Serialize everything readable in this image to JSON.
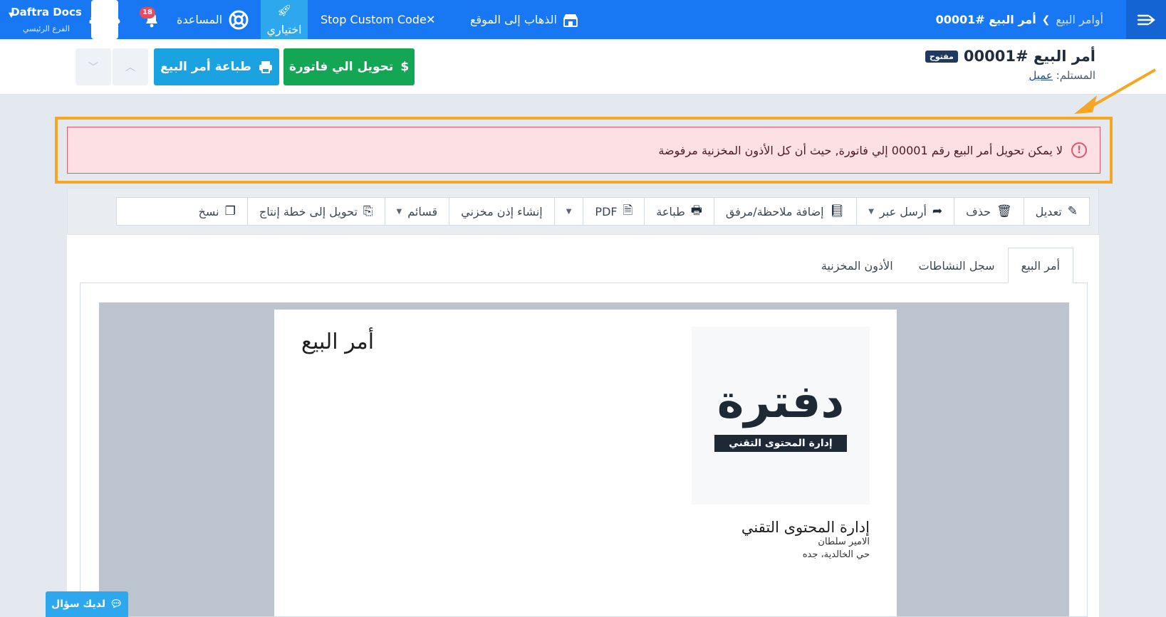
{
  "nav": {
    "breadcrumb_parent": "أوامر البيع",
    "breadcrumb_current": "أمر البيع #00001",
    "go_to_site": "الذهاب إلى الموقع",
    "stop_custom_code": "Stop Custom Code",
    "try_label": "اختياري",
    "help_label": "المساعدة",
    "notifications_count": "18",
    "logo_text": "دفترة",
    "account_name": "Daftra Docs",
    "branch_name": "الفرع الرئيسي"
  },
  "header": {
    "title": "أمر البيع #00001",
    "status": "مفتوح",
    "recipient_label": "المستلم:",
    "recipient_value": "عميل",
    "convert_invoice": "تحويل الي فاتورة",
    "print_order": "طباعة أمر البيع"
  },
  "alert": {
    "message": "لا يمكن تحويل أمر البيع رقم 00001 إلي فاتورة, حيث أن كل الأذون المخزنية مرفوضة"
  },
  "toolbar": {
    "edit": "تعديل",
    "delete": "حذف",
    "send_via": "أرسل عبر",
    "add_note": "إضافة ملاحظة/مرفق",
    "print": "طباعة",
    "pdf": "PDF",
    "create_stock_permit": "إنشاء إذن مخزني",
    "lists": "قسائم",
    "convert_production": "تحويل إلى خطة إنتاج",
    "copy": "نسخ"
  },
  "tabs": [
    "أمر البيع",
    "سجل النشاطات",
    "الأذون المخزنية"
  ],
  "document": {
    "title": "أمر البيع",
    "logo_wordmark": "دفترة",
    "logo_tag": "إدارة المحتوى التقني",
    "company_name": "إدارة المحتوى التقني",
    "address_line1": "الامير سلطان",
    "address_line2": "حي الخالدية، جده"
  },
  "help_float": "لديك سؤال",
  "colors": {
    "primary": "#1877f2",
    "success": "#13a654",
    "info": "#1aa3e0",
    "alert_bg": "#fde0e4",
    "highlight": "#f5a623"
  }
}
